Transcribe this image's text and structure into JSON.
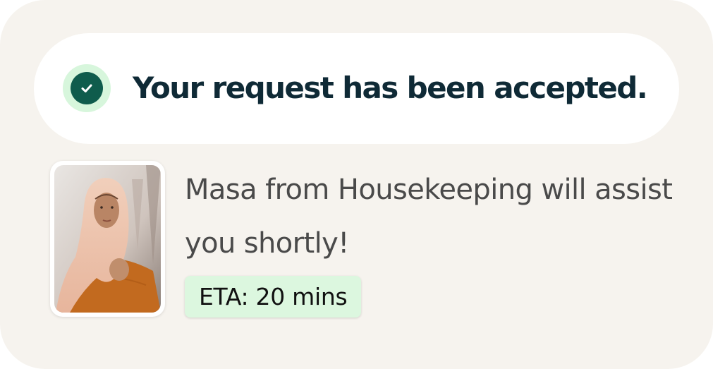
{
  "banner": {
    "title": "Your request has been accepted.",
    "status_icon": "check-circle-icon",
    "colors": {
      "icon_fill": "#0f5c4c",
      "icon_halo": "#d7f6dc",
      "title": "#0f2a36"
    }
  },
  "assignment": {
    "photo_alt": "Masa",
    "message": "Masa from Housekeeping will assist you shortly!",
    "eta": {
      "text": "ETA: 20 mins",
      "background": "#dcf7df"
    }
  },
  "colors": {
    "card_background": "#f6f3ee",
    "banner_background": "#ffffff"
  }
}
